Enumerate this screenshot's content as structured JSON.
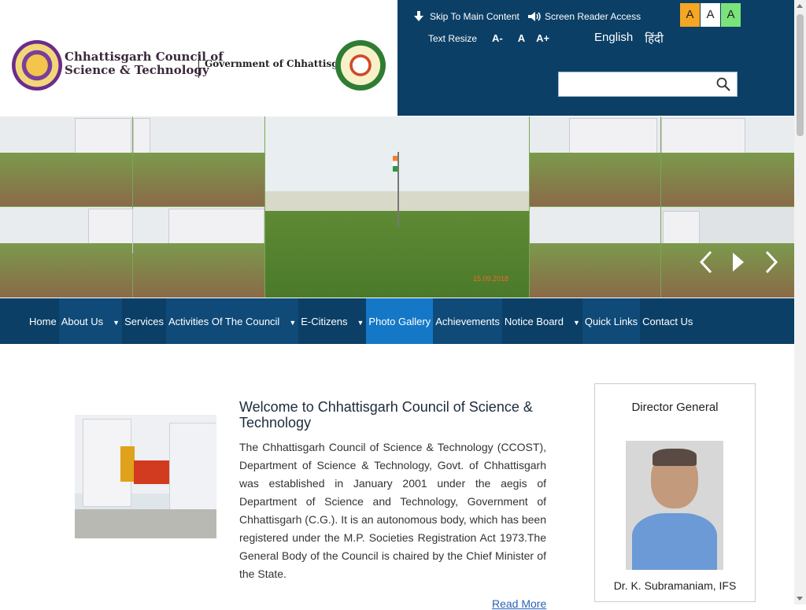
{
  "header": {
    "org_name_line1": "Chhattisgarh Council of",
    "org_name_line2": "Science & Technology",
    "gov_name": "Government of Chhattisgarh"
  },
  "utility": {
    "skip_label": "Skip To Main Content",
    "screen_reader_label": "Screen Reader Access",
    "text_resize_label": "Text Resize",
    "resize_small": "A-",
    "resize_normal": "A",
    "resize_large": "A+",
    "lang_english": "English",
    "lang_hindi": "हिंदी",
    "contrast_options": [
      {
        "label": "A",
        "color": "#f5a623",
        "text": "#222"
      },
      {
        "label": "A",
        "color": "#ffffff",
        "text": "#222"
      },
      {
        "label": "A",
        "color": "#7be37b",
        "text": "#222"
      }
    ],
    "search_placeholder": ""
  },
  "banner": {
    "date_stamp": "15.09.2018"
  },
  "nav": {
    "items": [
      {
        "label": "Home",
        "dropdown": false
      },
      {
        "label": "About Us",
        "dropdown": true
      },
      {
        "label": "Services",
        "dropdown": false
      },
      {
        "label": "Activities Of The Council",
        "dropdown": true
      },
      {
        "label": "E-Citizens",
        "dropdown": true
      },
      {
        "label": "Photo Gallery",
        "dropdown": false
      },
      {
        "label": "Achievements",
        "dropdown": false
      },
      {
        "label": "Notice Board",
        "dropdown": true
      },
      {
        "label": "Quick Links",
        "dropdown": false
      },
      {
        "label": "Contact Us",
        "dropdown": false
      }
    ]
  },
  "main": {
    "welcome_title": "Welcome to Chhattisgarh Council of Science & Technology",
    "welcome_text": "The Chhattisgarh Council of Science & Technology (CCOST), Department of Science & Technology, Govt. of Chhattisgarh was established in January 2001 under the aegis of Department of Science and Technology, Government of Chhattisgarh (C.G.). It is an autonomous body, which has been registered under the M.P. Societies Registration Act 1973.The General Body of the Council is chaired by the Chief Minister of the State.",
    "read_more": "Read More"
  },
  "director": {
    "title": "Director General",
    "name": "Dr. K. Subramaniam, IFS"
  },
  "colors": {
    "primary": "#0b3f66",
    "active_nav": "#1478c7",
    "link": "#2a62b5"
  }
}
